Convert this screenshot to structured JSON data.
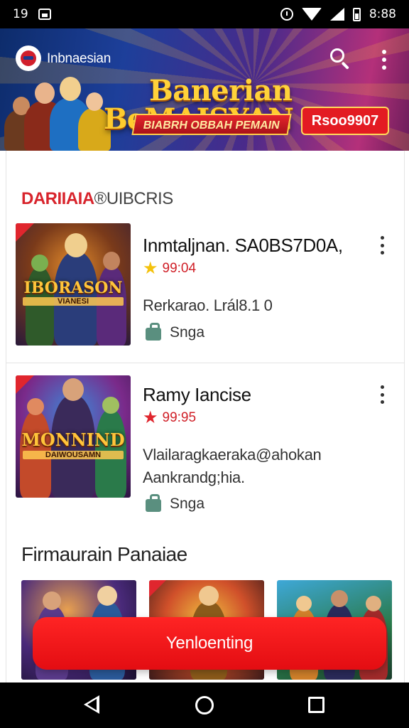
{
  "status_bar": {
    "left_text": "19",
    "time": "8:88",
    "icons": [
      "image-icon",
      "alarm-icon",
      "wifi-icon",
      "signal-icon",
      "battery-icon"
    ]
  },
  "header": {
    "brand_name": "Inbnaesian",
    "search_icon": "search-icon",
    "menu_icon": "more-vertical-icon",
    "banner": {
      "title_line_1": "Banerian",
      "title_line_2": "BeMAISYAN",
      "subtitle": "BIABRH OBBAH PEMAIN",
      "badge": "Rsoo9907"
    }
  },
  "section_title": {
    "accent": "DARIIAIA",
    "rest": "®UIBCRIS"
  },
  "games": [
    {
      "name": "Inmtaljnan. SA0BS7D0A,",
      "rating": "99:04",
      "star_color": "#f4c20d",
      "description_lines": [
        "Rerkarao. Lrál8.1 0"
      ],
      "category": "Snga",
      "art_title": "IBORASON",
      "art_subtitle": "VIANESI"
    },
    {
      "name": "Ramy Iancise",
      "rating": "99:95",
      "star_color": "#e0262e",
      "description_lines": [
        "Vlailaragkaeraka@ahokan",
        "Aankrandg;hia."
      ],
      "category": "Snga",
      "art_title": "MONNIND",
      "art_subtitle": "DAIWOUSAMN"
    }
  ],
  "section2_title": "Firmaurain Panaiae",
  "cta_button": "Yenloenting",
  "colors": {
    "accent_red": "#e31b22",
    "category_icon": "#5a8f7f",
    "banner_gold": "#ffd23a"
  },
  "nav_bar": {
    "icons": [
      "back-icon",
      "home-icon",
      "recent-apps-icon"
    ]
  }
}
